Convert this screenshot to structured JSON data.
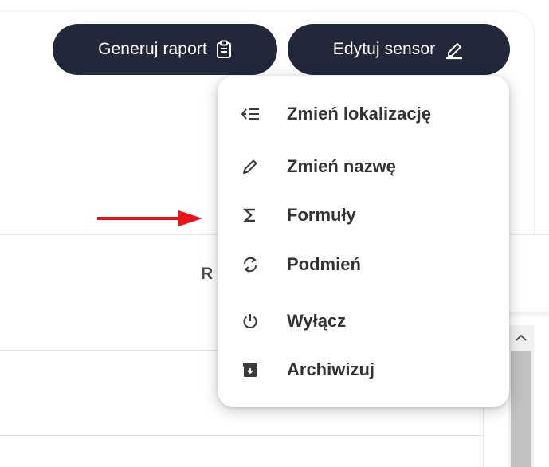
{
  "header": {
    "report_button_label": "Generuj raport",
    "edit_button_label": "Edytuj sensor"
  },
  "background": {
    "partial_column_label": "R"
  },
  "dropdown_menu": {
    "items": [
      {
        "label": "Zmień lokalizację",
        "icon": "list-move-icon"
      },
      {
        "label": "Zmień nazwę",
        "icon": "pencil-icon"
      },
      {
        "label": "Formuły",
        "icon": "sigma-icon"
      },
      {
        "label": "Podmień",
        "icon": "swap-icon"
      },
      {
        "label": "Wyłącz",
        "icon": "power-icon"
      },
      {
        "label": "Archiwizuj",
        "icon": "archive-icon"
      }
    ]
  },
  "colors": {
    "button_bg": "#22283a",
    "annotation_arrow": "#e8141a"
  }
}
